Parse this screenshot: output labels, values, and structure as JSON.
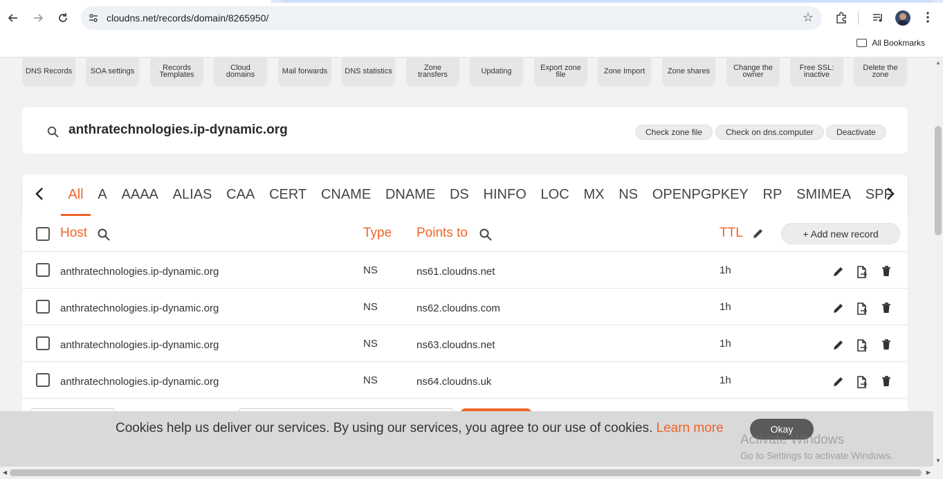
{
  "browser": {
    "url": "cloudns.net/records/domain/8265950/",
    "bookmarks_label": "All Bookmarks"
  },
  "toolbar": [
    "DNS Records",
    "SOA settings",
    "Records Templates",
    "Cloud domains",
    "Mail forwards",
    "DNS statistics",
    "Zone transfers",
    "Updating",
    "Export zone file",
    "Zone Import",
    "Zone shares",
    "Change the owner",
    "Free SSL: inactive",
    "Delete the zone"
  ],
  "zone": {
    "domain": "anthratechnologies.ip-dynamic.org",
    "actions": [
      "Check zone file",
      "Check on dns.computer",
      "Deactivate"
    ]
  },
  "record_types": [
    "All",
    "A",
    "AAAA",
    "ALIAS",
    "CAA",
    "CERT",
    "CNAME",
    "DNAME",
    "DS",
    "HINFO",
    "LOC",
    "MX",
    "NS",
    "OPENPGPKEY",
    "RP",
    "SMIMEA",
    "SPF"
  ],
  "active_type": "All",
  "table": {
    "headers": {
      "host": "Host",
      "type": "Type",
      "points_to": "Points to",
      "ttl": "TTL"
    },
    "add_label": "+ Add new record",
    "rows": [
      {
        "host": "anthratechnologies.ip-dynamic.org",
        "type": "NS",
        "points_to": "ns61.cloudns.net",
        "ttl": "1h"
      },
      {
        "host": "anthratechnologies.ip-dynamic.org",
        "type": "NS",
        "points_to": "ns62.cloudns.com",
        "ttl": "1h"
      },
      {
        "host": "anthratechnologies.ip-dynamic.org",
        "type": "NS",
        "points_to": "ns63.cloudns.net",
        "ttl": "1h"
      },
      {
        "host": "anthratechnologies.ip-dynamic.org",
        "type": "NS",
        "points_to": "ns64.cloudns.uk",
        "ttl": "1h"
      }
    ]
  },
  "cookie": {
    "message": "Cookies help us deliver our services. By using our services, you agree to our use of cookies.",
    "learn_more": "Learn more",
    "ok_label": "Okay"
  },
  "watermark": {
    "line1": "Activate Windows",
    "line2": "Go to Settings to activate Windows."
  },
  "colors": {
    "accent": "#f0642a",
    "button_bg": "#ececec",
    "page_bg": "#f2f2f2"
  }
}
